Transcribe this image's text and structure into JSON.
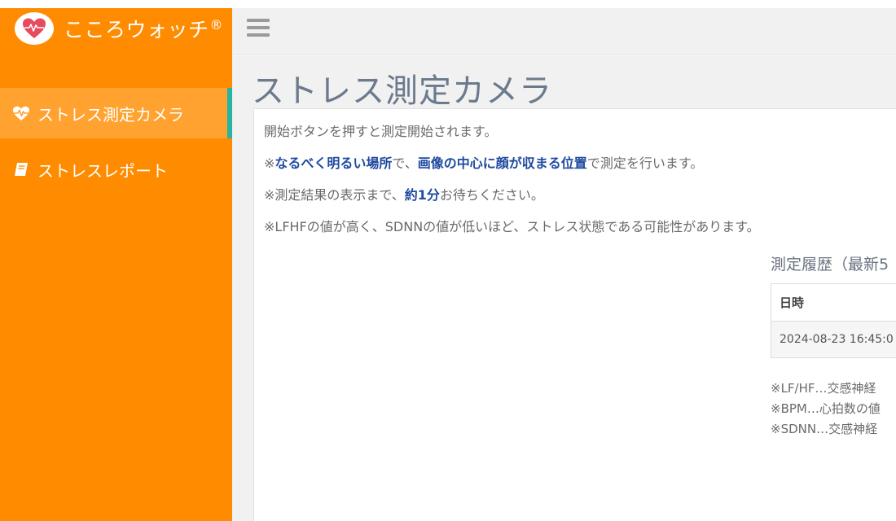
{
  "brand": {
    "name": "こころウォッチ",
    "mark": "®",
    "logo_icon": "heart-pulse-icon",
    "colors": {
      "sidebar": "#ff8c00",
      "active": "#ffa230",
      "accent": "#28b4a2",
      "heart": "#e84a5f"
    }
  },
  "sidebar": {
    "items": [
      {
        "label": "ストレス測定カメラ",
        "icon": "heartbeat-icon",
        "active": true
      },
      {
        "label": "ストレスレポート",
        "icon": "book-icon",
        "active": false
      }
    ]
  },
  "topbar": {
    "menu_icon": "hamburger-menu-icon"
  },
  "main": {
    "title": "ストレス測定カメラ",
    "instructions": {
      "line1": "開始ボタンを押すと測定開始されます。",
      "line2": {
        "prefix": "※",
        "bold1": "なるべく明るい場所",
        "mid": "で、",
        "bold2": "画像の中心に顔が収まる位置",
        "suffix": "で測定を行います。"
      },
      "line3": {
        "prefix": "※測定結果の表示まで、",
        "bold": "約1分",
        "suffix": "お待ちください。"
      },
      "line4": "※LFHFの値が高く、SDNNの値が低いほど、ストレス状態である可能性があります。"
    },
    "history": {
      "title": "測定履歴（最新5",
      "columns": [
        "日時"
      ],
      "rows": [
        [
          "2024-08-23 16:45:0"
        ]
      ]
    },
    "notes": [
      "※LF/HF…交感神経",
      "※BPM…心拍数の値",
      "※SDNN…交感神経"
    ]
  }
}
